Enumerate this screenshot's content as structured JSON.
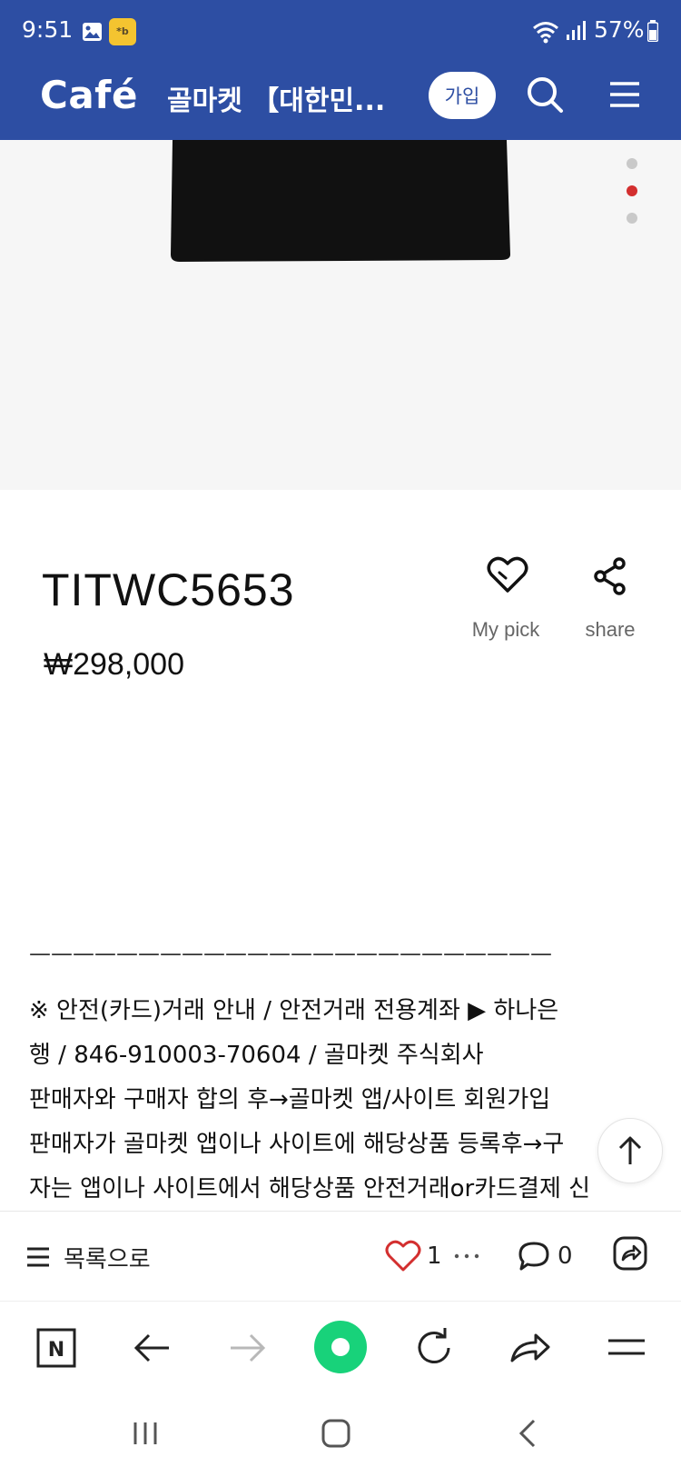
{
  "status_bar": {
    "time": "9:51",
    "battery": "57%",
    "icons": [
      "gallery-icon",
      "kb-app-icon",
      "wifi-icon",
      "signal-icon",
      "battery-icon"
    ]
  },
  "header": {
    "logo": "Café",
    "title": "골마켓 【대한민...",
    "join_label": "가입",
    "icons": [
      "search-icon",
      "menu-icon"
    ],
    "background_color": "#2d4ea3"
  },
  "carousel": {
    "slide_count": 3,
    "active_index": 1,
    "active_color": "#d32f2f",
    "inactive_color": "#c9c9c9"
  },
  "product": {
    "name": "TITWC5653",
    "price": "₩298,000",
    "mypick_label": "My pick",
    "share_label": "share"
  },
  "body": {
    "divider": "————————————————————————",
    "lines": [
      "※ 안전(카드)거래 안내 / 안전거래 전용계좌 ▶ 하나은",
      "행 / 846-910003-70604 / 골마켓 주식회사",
      "판매자와 구매자 합의 후→골마켓 앱/사이트 회원가입",
      "판매자가 골마켓 앱이나 사이트에 해당상품 등록후→구",
      "자는 앱이나 사이트에서 해당상품 안전거래or카드결제 신"
    ]
  },
  "post_actions": {
    "list_label": "목록으로",
    "like_count": "1",
    "comment_count": "0",
    "like_color": "#d32f2f"
  },
  "browser_toolbar": {
    "items": [
      "naver-icon",
      "back-arrow-icon",
      "forward-arrow-icon",
      "green-home-icon",
      "refresh-icon",
      "share-arrow-icon",
      "menu-icon"
    ]
  },
  "android_nav": {
    "items": [
      "recents-icon",
      "home-icon",
      "back-icon"
    ]
  }
}
